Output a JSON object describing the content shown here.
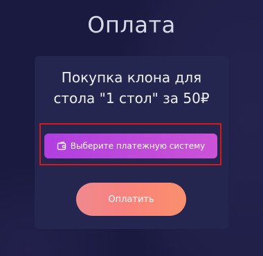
{
  "page": {
    "title": "Оплата"
  },
  "purchase": {
    "heading": "Покупка клона для стола \"1 стол\" за 50₽"
  },
  "payment_system": {
    "label": "Выберите платежную систему",
    "icon": "wallet-icon"
  },
  "actions": {
    "pay_label": "Оплатить"
  },
  "colors": {
    "background": "#1a1a40",
    "card": "#24264f",
    "payment_button": "#b13fe0",
    "pay_button": "#f7827f",
    "highlight_frame": "#d21a1a"
  }
}
